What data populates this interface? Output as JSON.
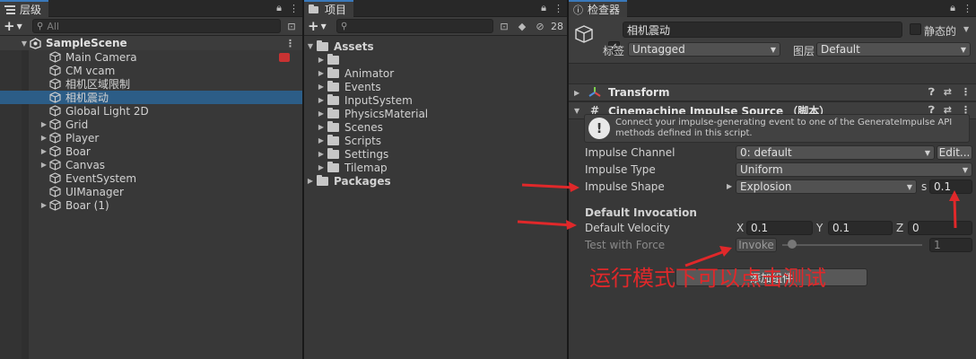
{
  "hierarchy": {
    "tab_label": "层级",
    "search_placeholder": "All",
    "scene": "SampleScene",
    "items": [
      {
        "label": "Main Camera",
        "expandable": false
      },
      {
        "label": "CM vcam",
        "expandable": false
      },
      {
        "label": "相机区域限制",
        "expandable": false
      },
      {
        "label": "相机震动",
        "expandable": false,
        "selected": true
      },
      {
        "label": "Global Light 2D",
        "expandable": false
      },
      {
        "label": "Grid",
        "expandable": true
      },
      {
        "label": "Player",
        "expandable": true
      },
      {
        "label": "Boar",
        "expandable": true
      },
      {
        "label": "Canvas",
        "expandable": true
      },
      {
        "label": "EventSystem",
        "expandable": false
      },
      {
        "label": "UIManager",
        "expandable": false
      },
      {
        "label": "Boar (1)",
        "expandable": true
      }
    ]
  },
  "project": {
    "tab_label": "项目",
    "hidden_count": "28",
    "root": "Assets",
    "folders": [
      "",
      "Animator",
      "Events",
      "InputSystem",
      "PhysicsMaterial",
      "Scenes",
      "Scripts",
      "Settings",
      "Tilemap"
    ],
    "packages": "Packages"
  },
  "inspector": {
    "tab_label": "检查器",
    "object_name": "相机震动",
    "static_label": "静态的",
    "tag_label": "标签",
    "tag_value": "Untagged",
    "layer_label": "图层",
    "layer_value": "Default",
    "transform_label": "Transform",
    "component_label": "Cinemachine Impulse Source （脚本）",
    "help_text": "Connect your impulse-generating event to one of the GenerateImpulse API methods defined in this script.",
    "impulse_channel_label": "Impulse Channel",
    "impulse_channel_value": "0: default",
    "edit_button": "Edit...",
    "impulse_type_label": "Impulse Type",
    "impulse_type_value": "Uniform",
    "impulse_shape_label": "Impulse Shape",
    "impulse_shape_value": "Explosion",
    "shape_s_label": "s",
    "shape_s_value": "0.1",
    "default_invocation_label": "Default Invocation",
    "default_velocity_label": "Default Velocity",
    "vel_x_label": "X",
    "vel_x": "0.1",
    "vel_y_label": "Y",
    "vel_y": "0.1",
    "vel_z_label": "Z",
    "vel_z": "0",
    "test_force_label": "Test with Force",
    "invoke_button": "Invoke",
    "force_value": "1",
    "add_component_button": "添加组件"
  },
  "annotation": {
    "text": "运行模式下可以点击测试",
    "color": "#e0282a"
  }
}
